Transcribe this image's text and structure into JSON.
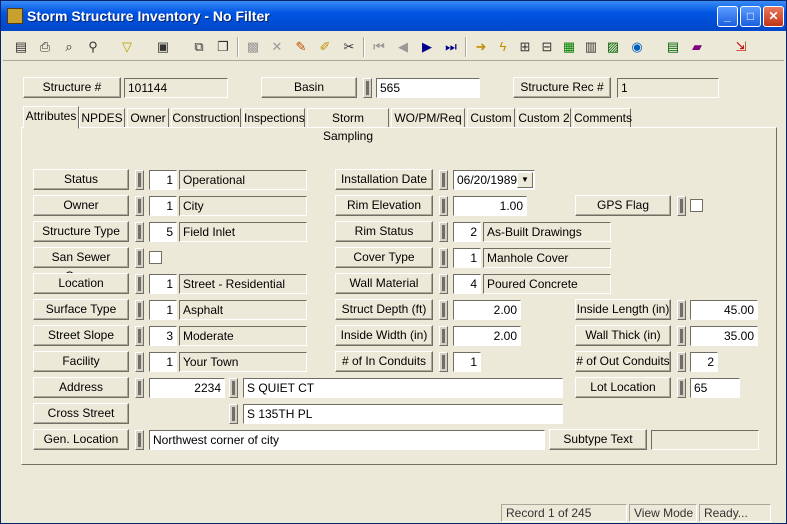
{
  "window": {
    "title": "Storm Structure Inventory - No Filter",
    "minimize": "_",
    "maximize": "□",
    "close": "✕"
  },
  "toolbar": {
    "icons": [
      "save",
      "print",
      "preview",
      "find",
      "filter",
      "report",
      "copy",
      "paste",
      "cut",
      "draw",
      "edit",
      "delete",
      "first",
      "prev",
      "next",
      "last",
      "go",
      "lightning",
      "tree",
      "map",
      "calc",
      "globe",
      "grid",
      "book",
      "exit"
    ]
  },
  "header": {
    "structure_label": "Structure #",
    "structure_value": "101144",
    "basin_label": "Basin",
    "basin_value": "565",
    "rec_label": "Structure Rec #",
    "rec_value": "1"
  },
  "tabs": [
    "Attributes",
    "NPDES",
    "Owner",
    "Construction",
    "Inspections",
    "Storm Sampling",
    "WO/PM/Req",
    "Custom",
    "Custom 2",
    "Comments"
  ],
  "left": {
    "status": {
      "label": "Status",
      "code": "1",
      "text": "Operational"
    },
    "owner": {
      "label": "Owner",
      "code": "1",
      "text": "City"
    },
    "structure_type": {
      "label": "Structure Type",
      "code": "5",
      "text": "Field Inlet"
    },
    "san_sewer": {
      "label": "San Sewer Conn."
    },
    "location": {
      "label": "Location",
      "code": "1",
      "text": "Street - Residential"
    },
    "surface_type": {
      "label": "Surface Type",
      "code": "1",
      "text": "Asphalt"
    },
    "street_slope": {
      "label": "Street Slope",
      "code": "3",
      "text": "Moderate"
    },
    "facility": {
      "label": "Facility",
      "code": "1",
      "text": "Your Town"
    },
    "address": {
      "label": "Address",
      "number": "2234",
      "street": "S QUIET CT"
    },
    "cross_street": {
      "label": "Cross Street",
      "value": "S 135TH PL"
    },
    "gen_location": {
      "label": "Gen. Location",
      "value": "Northwest corner of city"
    }
  },
  "mid": {
    "install_date": {
      "label": "Installation Date",
      "value": "06/20/1989"
    },
    "rim_elev": {
      "label": "Rim Elevation",
      "value": "1.00"
    },
    "rim_status": {
      "label": "Rim Status",
      "code": "2",
      "text": "As-Built Drawings"
    },
    "cover_type": {
      "label": "Cover Type",
      "code": "1",
      "text": "Manhole Cover"
    },
    "wall_material": {
      "label": "Wall Material",
      "code": "4",
      "text": "Poured Concrete"
    },
    "struct_depth": {
      "label": "Struct Depth (ft)",
      "value": "2.00"
    },
    "inside_width": {
      "label": "Inside Width (in)",
      "value": "2.00"
    },
    "in_conduits": {
      "label": "# of In Conduits",
      "value": "1"
    }
  },
  "right": {
    "gps": {
      "label": "GPS Flag"
    },
    "inside_length": {
      "label": "Inside Length (in)",
      "value": "45.00"
    },
    "wall_thick": {
      "label": "Wall Thick (in)",
      "value": "35.00"
    },
    "out_conduits": {
      "label": "# of Out Conduits",
      "value": "2"
    },
    "lot_location": {
      "label": "Lot Location",
      "value": "65"
    },
    "subtype": {
      "label": "Subtype Text",
      "value": ""
    }
  },
  "status": {
    "record": "Record 1 of 245",
    "mode": "View Mode",
    "state": "Ready..."
  }
}
